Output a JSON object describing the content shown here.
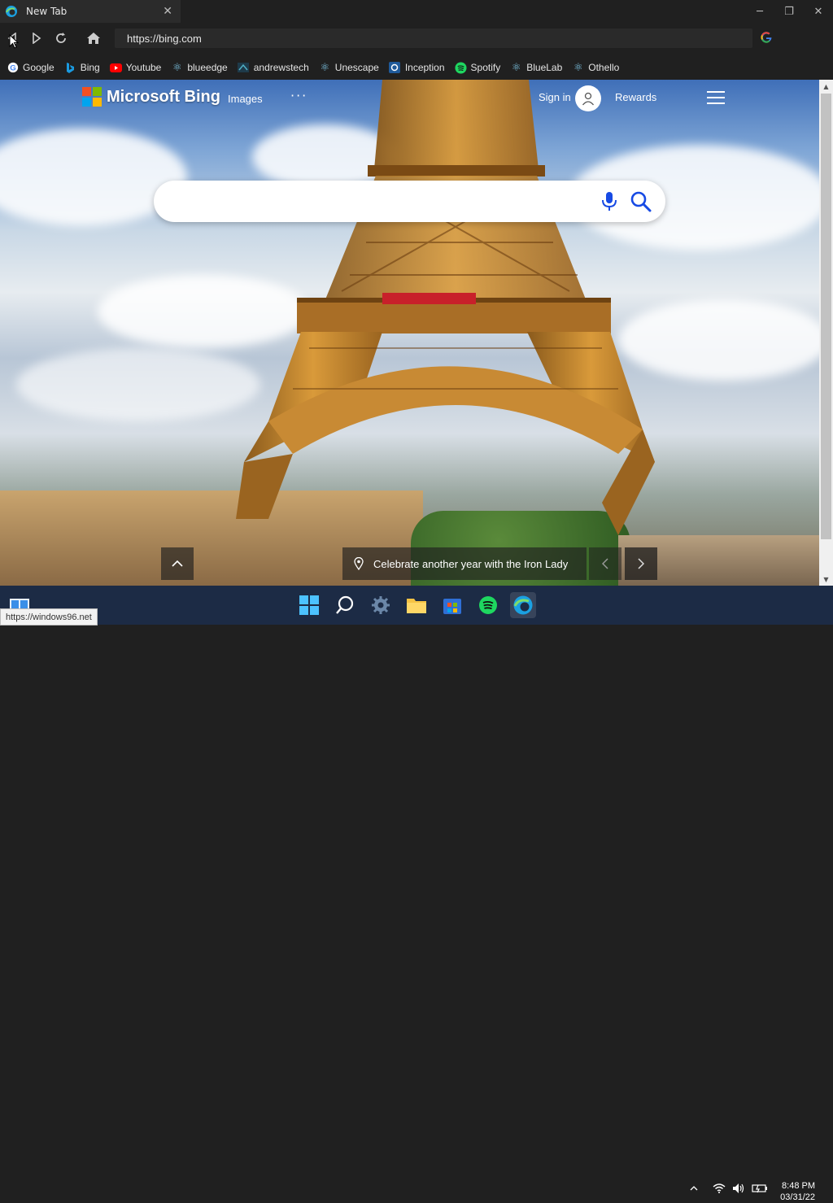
{
  "browser": {
    "tab_title": "New Tab",
    "url": "https://bing.com",
    "status_url": "https://windows96.net",
    "bookmarks": [
      "Google",
      "Bing",
      "Youtube",
      "blueedge",
      "andrewstech",
      "Unescape",
      "Inception",
      "Spotify",
      "BlueLab",
      "Othello"
    ]
  },
  "bing": {
    "logo_text": "Microsoft Bing",
    "images_label": "Images",
    "more_label": "···",
    "sign_in_label": "Sign in",
    "rewards_label": "Rewards",
    "search_placeholder": "",
    "caption": "Celebrate another year with the Iron Lady"
  },
  "taskbar": {
    "time": "8:48 PM",
    "date": "03/31/22"
  },
  "colors": {
    "chrome_bg": "#202020",
    "taskbar_bg": "#1c2b45",
    "accent_edge": "#1ba1e2"
  }
}
